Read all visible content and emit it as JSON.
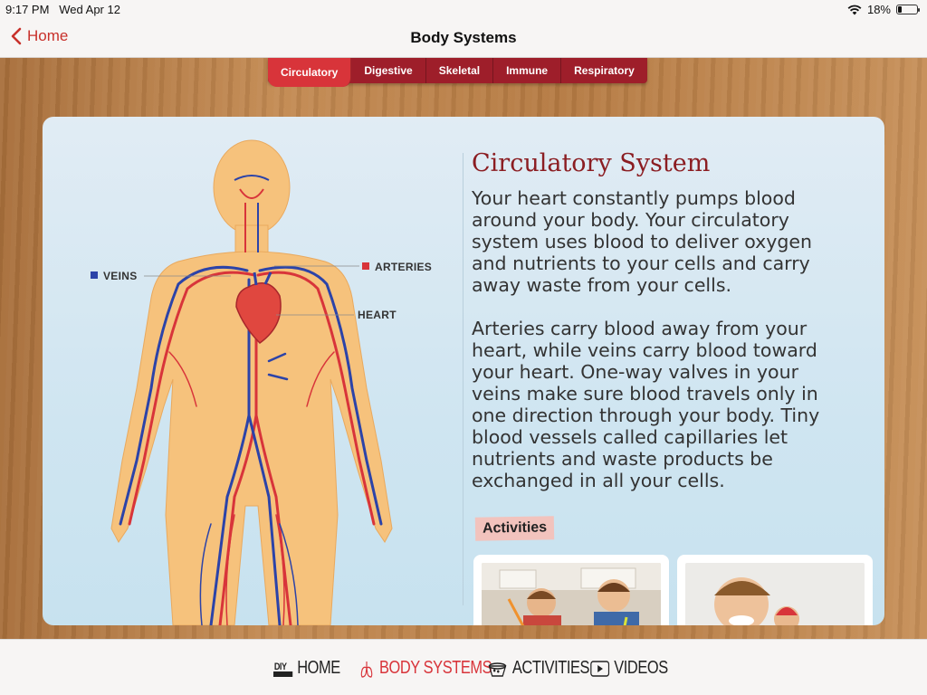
{
  "status": {
    "time": "9:17 PM",
    "date": "Wed Apr 12",
    "battery": "18%",
    "battery_level": 0.18
  },
  "nav": {
    "back_label": "Home",
    "title": "Body Systems"
  },
  "tabs": [
    {
      "label": "Circulatory",
      "active": true
    },
    {
      "label": "Digestive",
      "active": false
    },
    {
      "label": "Skeletal",
      "active": false
    },
    {
      "label": "Immune",
      "active": false
    },
    {
      "label": "Respiratory",
      "active": false
    }
  ],
  "illustration": {
    "labels": {
      "veins": "VEINS",
      "arteries": "ARTERIES",
      "heart": "HEART"
    },
    "colors": {
      "veins": "#2c43a8",
      "arteries": "#d8343a",
      "skin": "#f6c27c"
    }
  },
  "content": {
    "title": "Circulatory System",
    "paragraph1": "Your heart constantly pumps blood around your body. Your circulatory system uses blood to deliver oxygen and nutrients to your cells and carry away waste from your cells.",
    "paragraph2": "Arteries carry blood away from your heart, while veins carry blood toward your heart. One-way valves in your veins make sure blood travels only in one direction through your body. Tiny blood vessels called capillaries let nutrients and waste products be exchanged in all your cells.",
    "activities_label": "Activities"
  },
  "bottom_nav": [
    {
      "label": "HOME",
      "icon": "diy-logo-icon",
      "badge": "DIY",
      "active": false
    },
    {
      "label": "BODY SYSTEMS",
      "icon": "lungs-icon",
      "active": true
    },
    {
      "label": "ACTIVITIES",
      "icon": "bowl-icon",
      "active": false
    },
    {
      "label": "VIDEOS",
      "icon": "play-icon",
      "active": false
    }
  ],
  "colors": {
    "accent": "#d8343a",
    "tab_bar": "#9e1e2a",
    "title": "#8b1d22"
  }
}
